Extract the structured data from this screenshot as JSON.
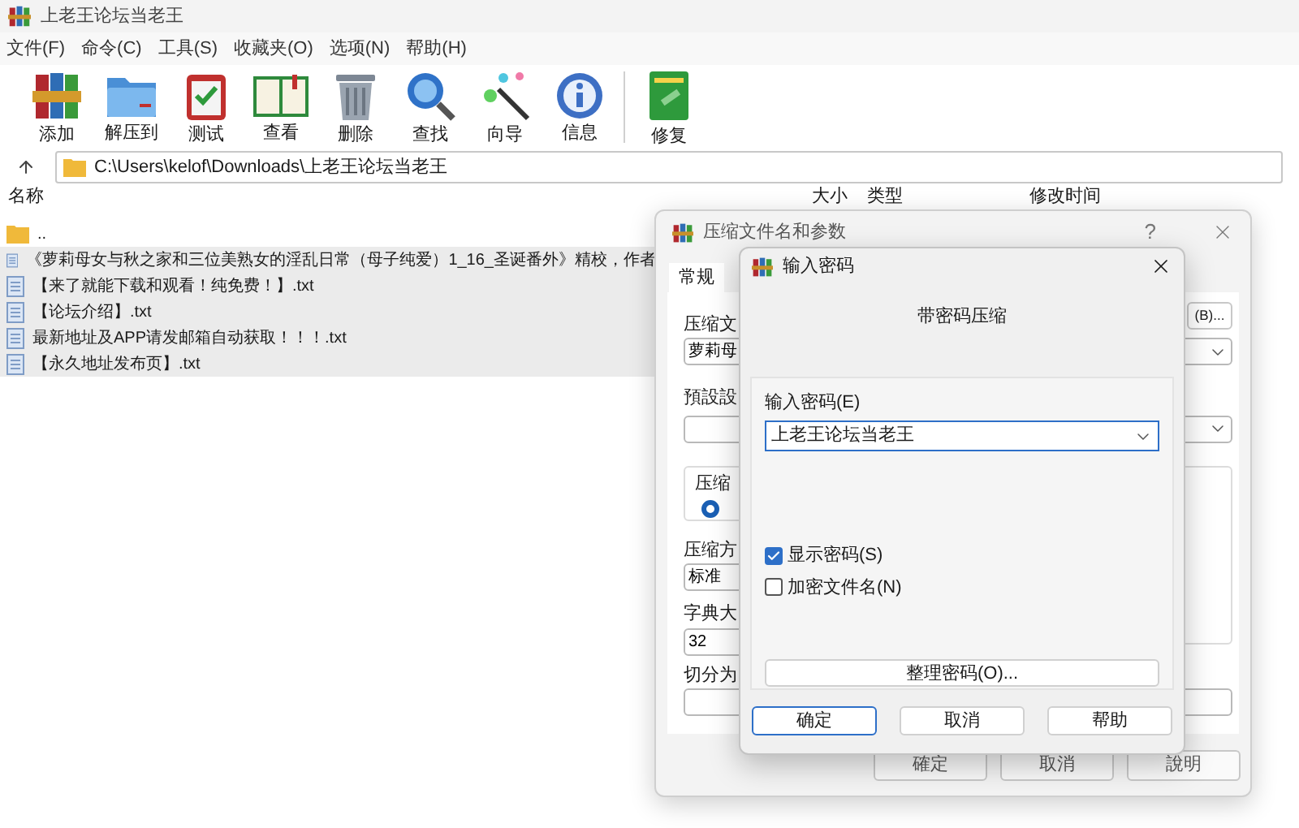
{
  "window": {
    "title": "上老王论坛当老王"
  },
  "menu": [
    "文件(F)",
    "命令(C)",
    "工具(S)",
    "收藏夹(O)",
    "选项(N)",
    "帮助(H)"
  ],
  "toolbar": [
    [
      "添加",
      "解压到",
      "测试",
      "查看",
      "删除",
      "查找",
      "向导",
      "信息"
    ],
    [
      "修复"
    ]
  ],
  "address": {
    "value": "C:\\Users\\kelof\\Downloads\\上老王论坛当老王"
  },
  "columns": [
    "名称",
    "大小",
    "类型",
    "修改时间"
  ],
  "files": [
    {
      "name": "..",
      "kind": "folder",
      "selected": false
    },
    {
      "name": "《萝莉母女与秋之家和三位美熟女的淫乱日常（母子纯爱）1_16_圣诞番外》精校，作者",
      "kind": "file",
      "selected": true
    },
    {
      "name": "【来了就能下载和观看！纯免费！】.txt",
      "kind": "file",
      "selected": true
    },
    {
      "name": "【论坛介绍】.txt",
      "kind": "file",
      "selected": true
    },
    {
      "name": "最新地址及APP请发邮箱自动获取！！！.txt",
      "kind": "file",
      "selected": true
    },
    {
      "name": "【永久地址发布页】.txt",
      "kind": "file",
      "selected": true
    }
  ],
  "archive_dialog": {
    "title": "压缩文件名和参数",
    "help_glyph": "?",
    "tabs": [
      {
        "label": "常规",
        "selected": true
      }
    ],
    "archive_name_label": "压缩文",
    "browse_button": "(B)...",
    "archive_name": "萝莉母",
    "profile_label": "預設設",
    "group_label": "压缩",
    "radio_selected": true,
    "method_label": "压缩方",
    "method": "标准",
    "dict_label": "字典大",
    "dict": "32",
    "split_label": "切分为",
    "buttons": [
      "確定",
      "取消",
      "說明"
    ]
  },
  "password_dialog": {
    "title": "输入密码",
    "heading": "带密码压缩",
    "password_label": "输入密码(E)",
    "password": "上老王论坛当老王",
    "options": [
      {
        "label": "显示密码(S)",
        "checked": true
      },
      {
        "label": "加密文件名(N)",
        "checked": false
      }
    ],
    "organize_button": "整理密码(O)...",
    "buttons": [
      {
        "label": "确定",
        "default": true
      },
      {
        "label": "取消",
        "default": false
      },
      {
        "label": "帮助",
        "default": false
      }
    ]
  }
}
